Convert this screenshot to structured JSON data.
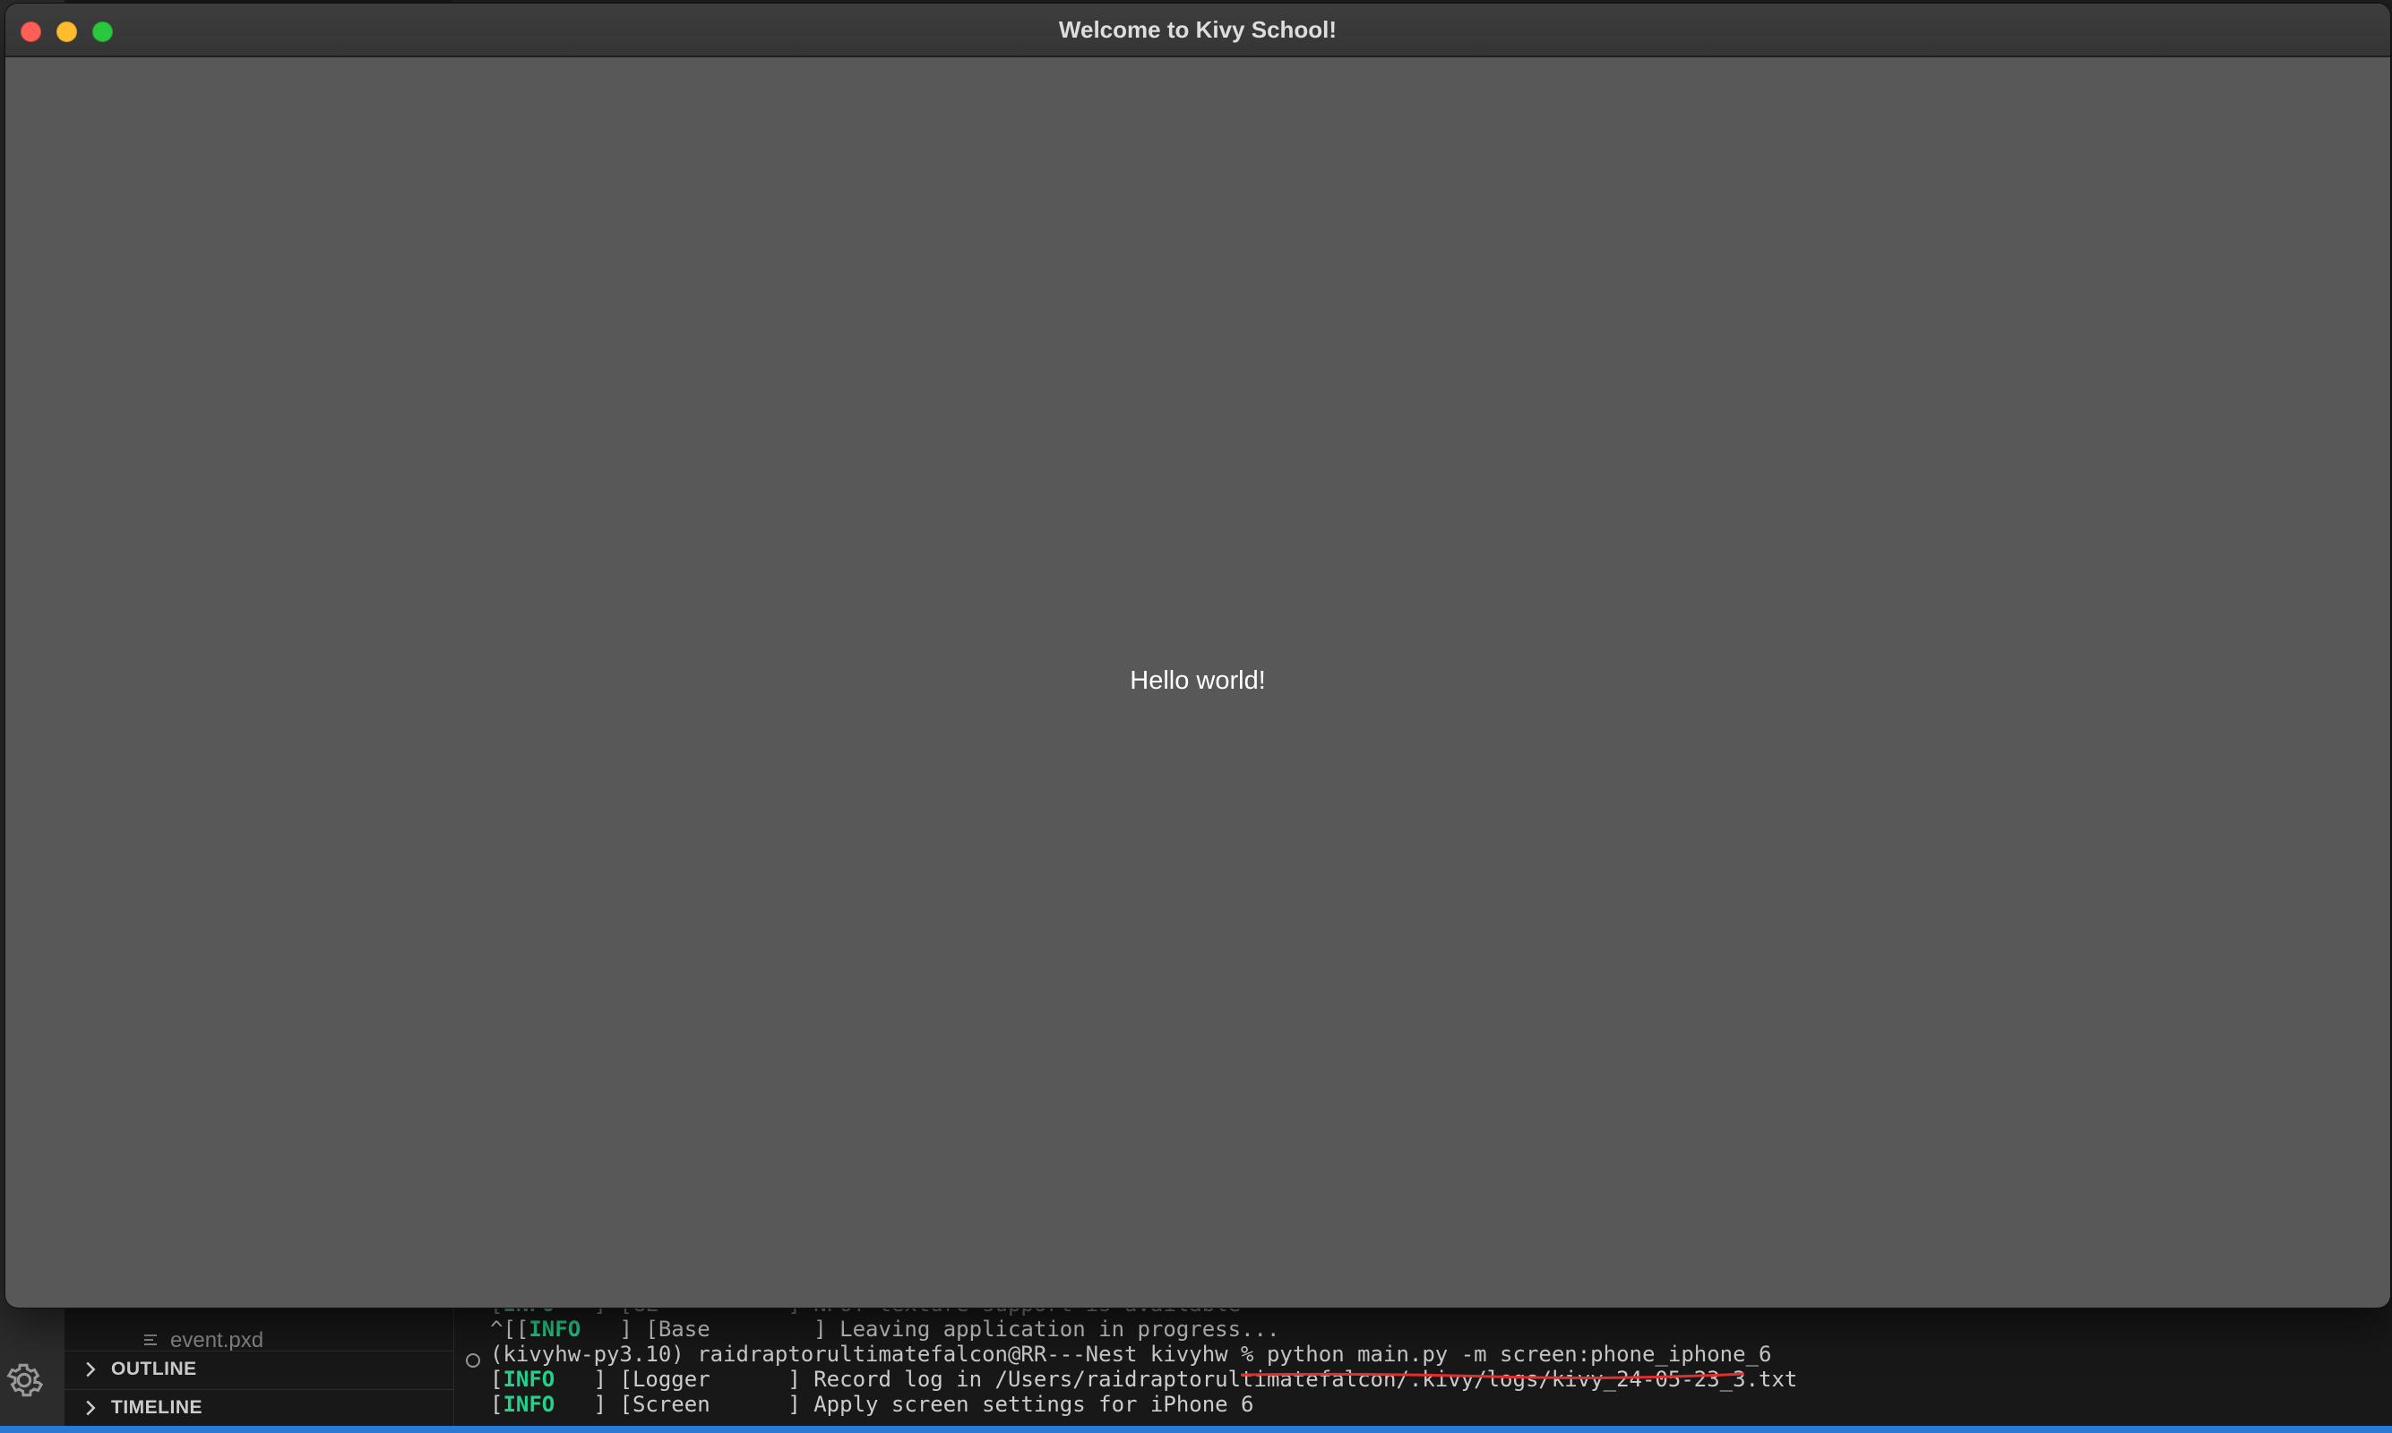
{
  "window": {
    "title": "Welcome to Kivy School!",
    "label_text": "Hello world!"
  },
  "sidebar": {
    "file_partial": "event.pxd",
    "outline_label": "OUTLINE",
    "timeline_label": "TIMELINE"
  },
  "terminal": {
    "lines": [
      {
        "prefix": "[",
        "tag": "INFO",
        "rest": "   ] [GL          ] NPOT texture support is available"
      },
      {
        "prefix": "^[[",
        "tag": "INFO",
        "rest": "   ] [Base        ] Leaving application in progress..."
      },
      {
        "prompt": "(kivyhw-py3.10) raidraptorultimatefalcon@RR---Nest kivyhw % ",
        "command": "python main.py -m screen:phone_iphone_6"
      },
      {
        "prefix": "[",
        "tag": "INFO",
        "rest": "   ] [Logger      ] Record log in /Users/raidraptorultimatefalcon/.kivy/logs/kivy_24-05-23_3.txt"
      },
      {
        "prefix": "[",
        "tag": "INFO",
        "rest": "   ] [Screen      ] Apply screen settings for iPhone 6"
      }
    ]
  },
  "colors": {
    "kivy_bg": "#585858",
    "terminal_info": "#23d18b",
    "status_bar": "#2a7ad5",
    "annotation_red": "#e03030"
  }
}
